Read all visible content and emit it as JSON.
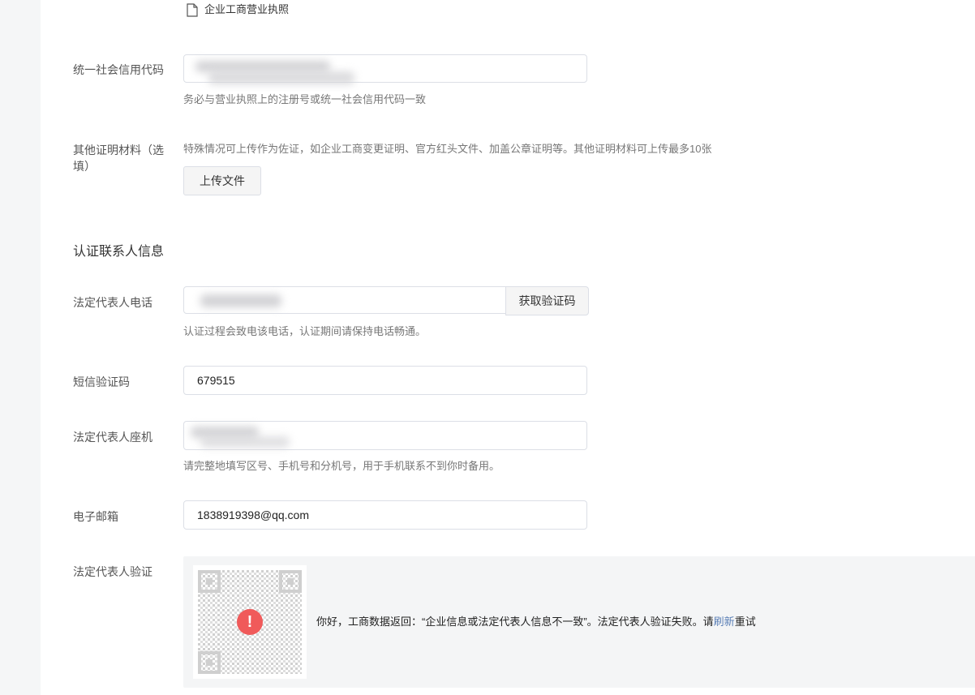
{
  "file": {
    "name": "企业工商营业执照"
  },
  "credit_code": {
    "label": "统一社会信用代码",
    "help": "务必与营业执照上的注册号或统一社会信用代码一致"
  },
  "other_docs": {
    "label_line1": "其他证明材料（选",
    "label_line2": "填）",
    "help": "特殊情况可上传作为佐证，如企业工商变更证明、官方红头文件、加盖公章证明等。其他证明材料可上传最多10张",
    "upload_button": "上传文件"
  },
  "contact_section": {
    "title": "认证联系人信息"
  },
  "legal_phone": {
    "label": "法定代表人电话",
    "get_code_button": "获取验证码",
    "help": "认证过程会致电该电话，认证期间请保持电话畅通。"
  },
  "sms_code": {
    "label": "短信验证码",
    "value": "679515"
  },
  "landline": {
    "label": "法定代表人座机",
    "help": "请完整地填写区号、手机号和分机号，用于手机联系不到你时备用。"
  },
  "email": {
    "label": "电子邮箱",
    "value": "1838919398@qq.com"
  },
  "legal_verify": {
    "label": "法定代表人验证",
    "message_before": "你好，工商数据返回：“企业信息或法定代表人信息不一致”。法定代表人验证失败。请",
    "refresh_link": "刷新",
    "message_after": "重试",
    "warning_icon_glyph": "!"
  },
  "colors": {
    "warning": "#f05a5a",
    "link": "#5a7fb6",
    "panel_bg": "#f4f5f6"
  }
}
